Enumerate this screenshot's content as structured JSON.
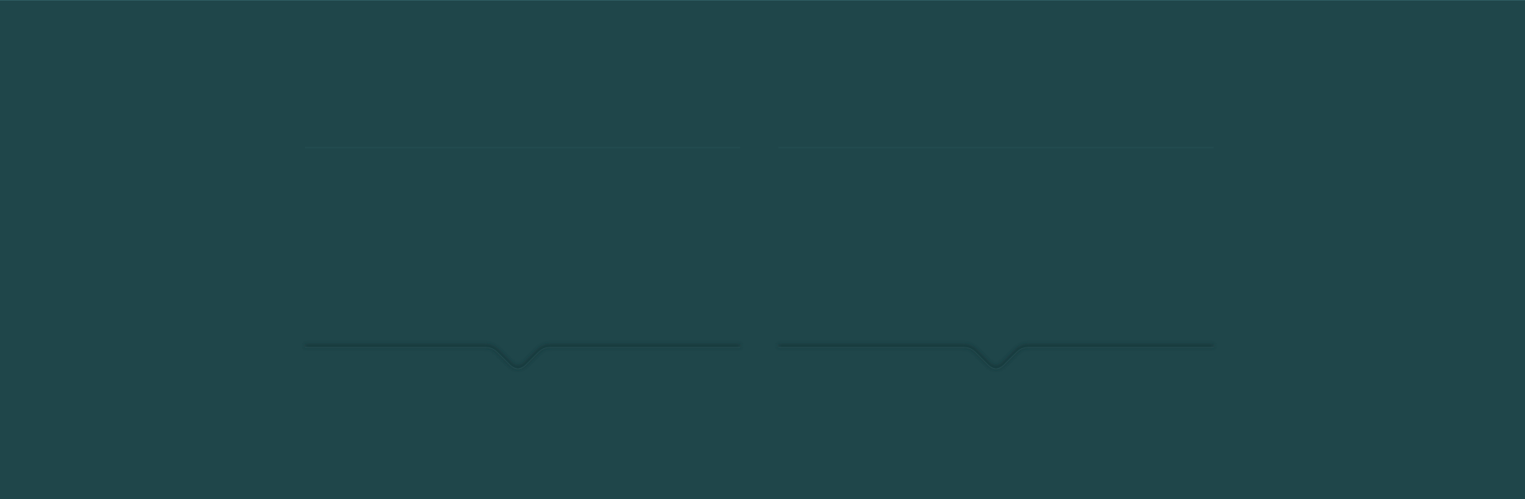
{
  "colors": {
    "background": "#1f464a",
    "shadow": "#163538",
    "highlight": "#2b5a5e"
  },
  "panels": [
    {
      "id": "left",
      "pointer": "bottom-center"
    },
    {
      "id": "right",
      "pointer": "bottom-center"
    }
  ]
}
